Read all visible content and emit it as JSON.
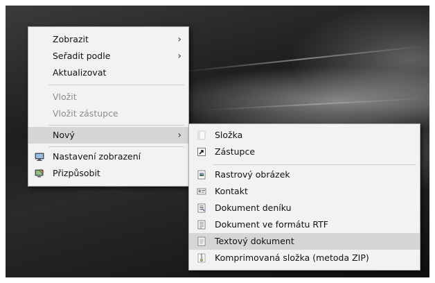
{
  "context_menu": {
    "items": [
      {
        "label": "Zobrazit",
        "arrow": "›"
      },
      {
        "label": "Seřadit podle",
        "arrow": "›"
      },
      {
        "label": "Aktualizovat"
      },
      {
        "label": "Vložit",
        "disabled": true
      },
      {
        "label": "Vložit zástupce",
        "disabled": true
      },
      {
        "label": "Nový",
        "arrow": "›",
        "highlighted": true
      },
      {
        "label": "Nastavení zobrazení",
        "icon": "display-settings-icon"
      },
      {
        "label": "Přizpůsobit",
        "icon": "personalize-icon"
      }
    ]
  },
  "submenu_new": {
    "items": [
      {
        "label": "Složka",
        "icon": "folder-icon"
      },
      {
        "label": "Zástupce",
        "icon": "shortcut-icon"
      },
      {
        "label": "Rastrový obrázek",
        "icon": "bitmap-image-icon"
      },
      {
        "label": "Kontakt",
        "icon": "contact-card-icon"
      },
      {
        "label": "Dokument deníku",
        "icon": "journal-document-icon"
      },
      {
        "label": "Dokument ve formátu RTF",
        "icon": "rtf-document-icon"
      },
      {
        "label": "Textový dokument",
        "icon": "text-document-icon",
        "highlighted": true
      },
      {
        "label": "Komprimovaná složka (metoda ZIP)",
        "icon": "zip-folder-icon"
      }
    ]
  },
  "colors": {
    "menu_background": "#f2f2f2",
    "highlight": "#d6d6d6",
    "disabled_text": "#8d8d8d"
  }
}
